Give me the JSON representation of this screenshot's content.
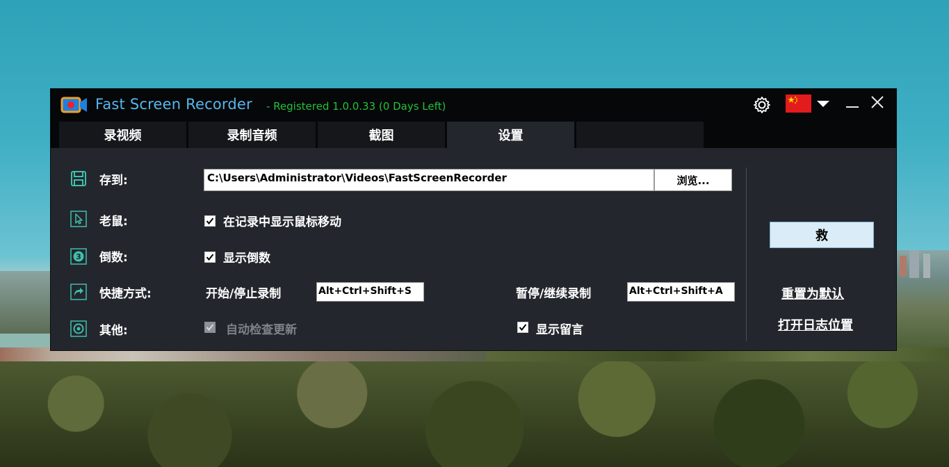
{
  "app": {
    "title": "Fast Screen Recorder",
    "status": "- Registered 1.0.0.33 (0 Days Left)",
    "accent_color": "#57b7ee",
    "status_color": "#22c23a",
    "language_flag": "china-flag-icon"
  },
  "tabs": [
    {
      "label": "录视频",
      "active": false
    },
    {
      "label": "录制音频",
      "active": false
    },
    {
      "label": "截图",
      "active": false
    },
    {
      "label": "设置",
      "active": true
    },
    {
      "label": "",
      "active": false
    }
  ],
  "settings": {
    "save_to": {
      "label": "存到:",
      "icon": "save-icon",
      "path": "C:\\Users\\Administrator\\Videos\\FastScreenRecorder",
      "browse_label": "浏览..."
    },
    "mouse": {
      "label": "老鼠:",
      "icon": "cursor-icon",
      "show_mouse_label": "在记录中显示鼠标移动",
      "show_mouse_checked": true
    },
    "countdown": {
      "label": "倒数:",
      "icon": "countdown-icon",
      "show_countdown_label": "显示倒数",
      "show_countdown_checked": true
    },
    "shortcuts": {
      "label": "快捷方式:",
      "icon": "shortcut-icon",
      "start_stop_label": "开始/停止录制",
      "start_stop_value": "Alt+Ctrl+Shift+S",
      "pause_resume_label": "暂停/继续录制",
      "pause_resume_value": "Alt+Ctrl+Shift+A"
    },
    "other": {
      "label": "其他:",
      "icon": "settings-icon",
      "auto_update_label": "自动检查更新",
      "auto_update_checked": true,
      "auto_update_enabled": false,
      "show_message_label": "显示留言",
      "show_message_checked": true
    }
  },
  "actions": {
    "save_label": "救",
    "reset_label": "重置为默认",
    "open_log_label": "打开日志位置"
  }
}
